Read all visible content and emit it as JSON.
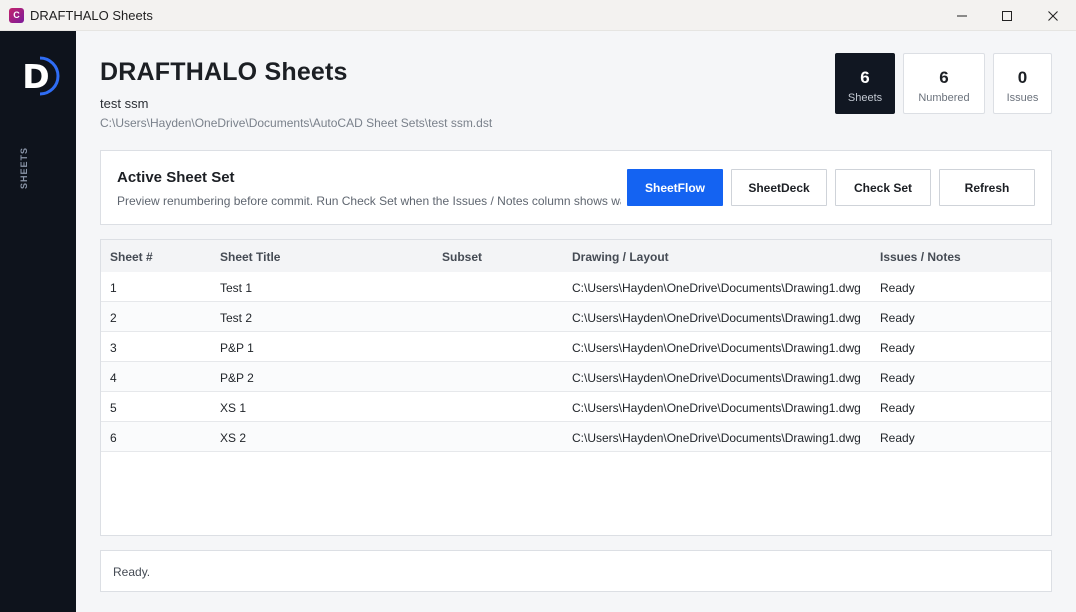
{
  "window": {
    "title": "DRAFTHALO Sheets",
    "icon_letter": "C",
    "controls": [
      "minimize-icon",
      "maximize-icon",
      "close-icon"
    ]
  },
  "sidebar": {
    "logo_letter": "D",
    "nav_label": "SHEETS"
  },
  "header": {
    "title": "DRAFTHALO Sheets",
    "set_name": "test ssm",
    "set_path": "C:\\Users\\Hayden\\OneDrive\\Documents\\AutoCAD Sheet Sets\\test ssm.dst"
  },
  "stats": [
    {
      "value": "6",
      "label": "Sheets",
      "active": true
    },
    {
      "value": "6",
      "label": "Numbered",
      "active": false
    },
    {
      "value": "0",
      "label": "Issues",
      "active": false
    }
  ],
  "panel": {
    "title": "Active Sheet Set",
    "description": "Preview renumbering before commit. Run Check Set when the Issues / Notes column shows warnings.",
    "buttons": {
      "sheetflow": "SheetFlow",
      "sheetdeck": "SheetDeck",
      "checkset": "Check Set",
      "refresh": "Refresh"
    }
  },
  "table": {
    "columns": [
      "Sheet #",
      "Sheet Title",
      "Subset",
      "Drawing / Layout",
      "Issues / Notes"
    ],
    "rows": [
      {
        "num": "1",
        "title": "Test 1",
        "subset": "",
        "drawing": "C:\\Users\\Hayden\\OneDrive\\Documents\\Drawing1.dwg",
        "notes": "Ready"
      },
      {
        "num": "2",
        "title": "Test 2",
        "subset": "",
        "drawing": "C:\\Users\\Hayden\\OneDrive\\Documents\\Drawing1.dwg",
        "notes": "Ready"
      },
      {
        "num": "3",
        "title": "P&P 1",
        "subset": "",
        "drawing": "C:\\Users\\Hayden\\OneDrive\\Documents\\Drawing1.dwg",
        "notes": "Ready"
      },
      {
        "num": "4",
        "title": "P&P 2",
        "subset": "",
        "drawing": "C:\\Users\\Hayden\\OneDrive\\Documents\\Drawing1.dwg",
        "notes": "Ready"
      },
      {
        "num": "5",
        "title": "XS 1",
        "subset": "",
        "drawing": "C:\\Users\\Hayden\\OneDrive\\Documents\\Drawing1.dwg",
        "notes": "Ready"
      },
      {
        "num": "6",
        "title": "XS 2",
        "subset": "",
        "drawing": "C:\\Users\\Hayden\\OneDrive\\Documents\\Drawing1.dwg",
        "notes": "Ready"
      }
    ]
  },
  "status": {
    "text": "Ready."
  },
  "colors": {
    "sidebar_bg": "#0e131c",
    "accent": "#1463f2",
    "logo_ring": "#2f6df5"
  }
}
